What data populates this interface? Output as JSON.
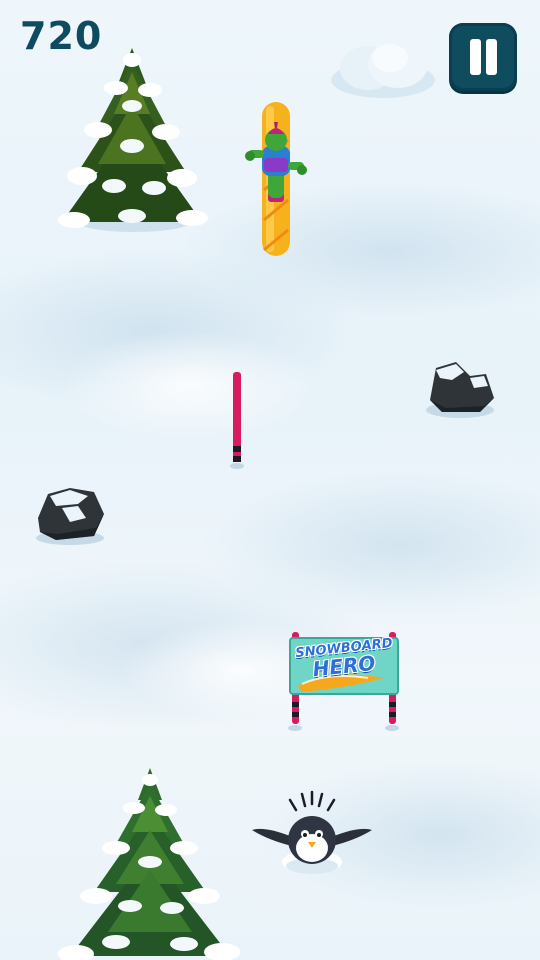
{
  "hud": {
    "score": "720",
    "pause_icon": "pause-icon"
  },
  "sign": {
    "line1": "SNOWBOARD",
    "line2": "HERO"
  },
  "colors": {
    "hud_text": "#0e4a60",
    "pause_bg": "#0f4c5e",
    "gate_pole": "#d81b5e",
    "board": "#f6b21d",
    "snow": "#eef6fb"
  },
  "objects": [
    "pine-tree",
    "snowboarder",
    "cloud",
    "gate-pole",
    "rock",
    "rock",
    "snowboard-hero-sign",
    "penguin",
    "pine-tree"
  ]
}
